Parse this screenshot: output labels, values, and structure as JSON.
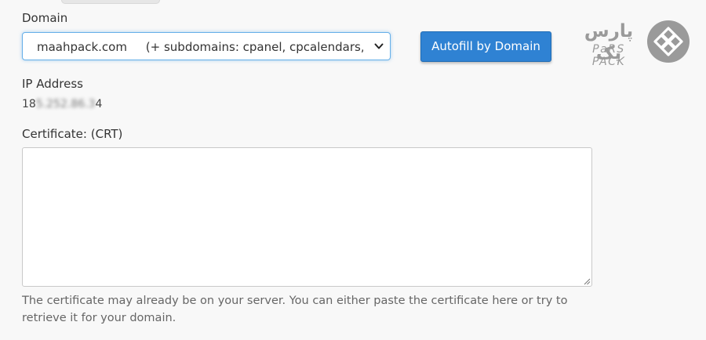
{
  "domain_section": {
    "label": "Domain",
    "selected_value": "maahpack.com     (+ subdomains: cpanel, cpcalendars, cpcontacts, mail, webdisk, webmail, www)",
    "autofill_button_label": "Autofill by Domain"
  },
  "ip_section": {
    "label": "IP Address",
    "value_visible_prefix": "18",
    "value_obscured": "5.252.86.3",
    "value_visible_suffix": "4"
  },
  "certificate_section": {
    "label": "Certificate: (CRT)",
    "textarea_value": "",
    "help_text": "The certificate may already be on your server. You can either paste the certificate here or try to retrieve it for your domain."
  },
  "logo": {
    "text_fa": "پارس پک",
    "text_en": "PaRS PACK"
  },
  "colors": {
    "button_primary": "#2f82d3",
    "focus_border": "#66afe9",
    "logo_gray": "#9a9a9a"
  },
  "icons": {
    "select_caret": "chevron-down-icon",
    "resize_handle": "resize-grip-icon",
    "logo_mark": "diamond-grid-logo-icon"
  }
}
